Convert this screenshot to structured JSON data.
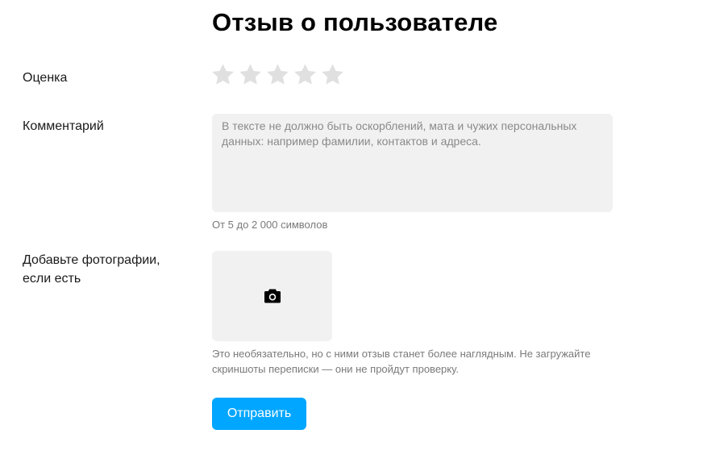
{
  "form": {
    "title": "Отзыв о пользователе",
    "rating": {
      "label": "Оценка",
      "value": 0,
      "max": 5,
      "star_color_empty": "#e0e0e0"
    },
    "comment": {
      "label": "Комментарий",
      "value": "",
      "placeholder": "В тексте не должно быть оскорблений, мата и чужих персональных данных: например фамилии, контактов и адреса.",
      "hint": "От 5 до 2 000 символов"
    },
    "photos": {
      "label": "Добавьте фотографии, если есть",
      "icon": "camera-icon",
      "hint": "Это необязательно, но с ними отзыв станет более наглядным. Не загружайте скриншоты переписки — они не пройдут проверку."
    },
    "submit": {
      "label": "Отправить",
      "color": "#00a6ff"
    }
  }
}
